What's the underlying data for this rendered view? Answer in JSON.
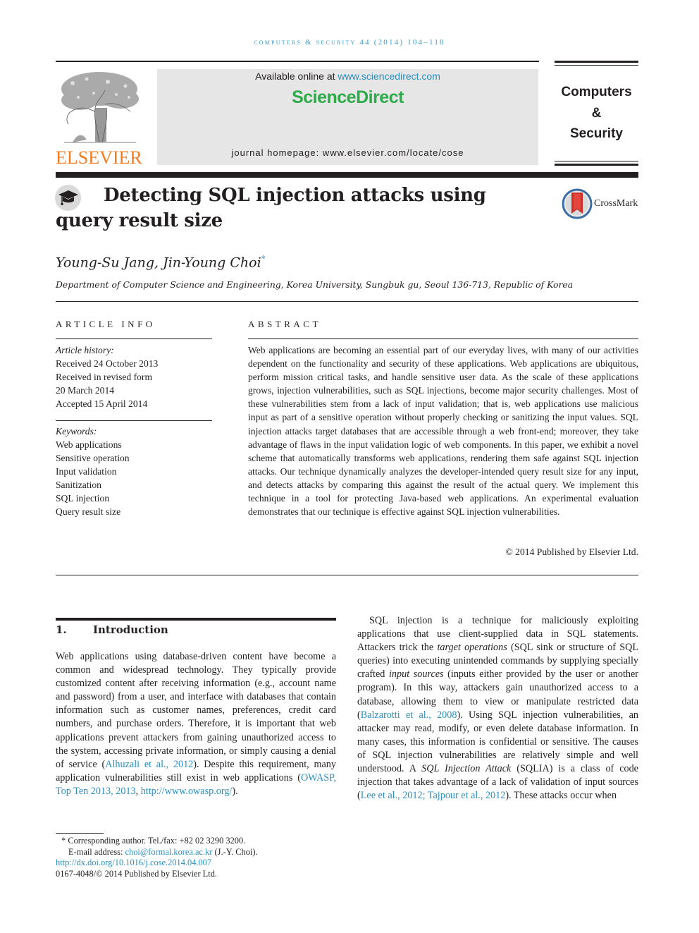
{
  "running_head": "computers & security 44 (2014) 104–118",
  "header": {
    "publisher_logo": "ELSEVIER",
    "available_online_prefix": "Available online at ",
    "available_online_link": "www.sciencedirect.com",
    "brand": "ScienceDirect",
    "journal_homepage": "journal homepage: www.elsevier.com/locate/cose",
    "journal_name_lines": [
      "Computers",
      "&",
      "Security"
    ]
  },
  "article": {
    "title": "Detecting SQL injection attacks using query result size",
    "crossmark_label": "CrossMark",
    "authors": "Young-Su Jang, Jin-Young Choi",
    "corresponding_marker": "*",
    "affiliation": "Department of Computer Science and Engineering, Korea University, Sungbuk gu, Seoul 136-713, Republic of Korea"
  },
  "article_info": {
    "heading": "ARTICLE INFO",
    "history_label": "Article history:",
    "history": [
      "Received 24 October 2013",
      "Received in revised form",
      "20 March 2014",
      "Accepted 15 April 2014"
    ],
    "keywords_label": "Keywords:",
    "keywords": [
      "Web applications",
      "Sensitive operation",
      "Input validation",
      "Sanitization",
      "SQL injection",
      "Query result size"
    ]
  },
  "abstract": {
    "heading": "ABSTRACT",
    "text": "Web applications are becoming an essential part of our everyday lives, with many of our activities dependent on the functionality and security of these applications. Web applications are ubiquitous, perform mission critical tasks, and handle sensitive user data. As the scale of these applications grows, injection vulnerabilities, such as SQL injections, become major security challenges. Most of these vulnerabilities stem from a lack of input validation; that is, web applications use malicious input as part of a sensitive operation without properly checking or sanitizing the input values. SQL injection attacks target databases that are accessible through a web front-end; moreover, they take advantage of flaws in the input validation logic of web components. In this paper, we exhibit a novel scheme that automatically transforms web applications, rendering them safe against SQL injection attacks. Our technique dynamically analyzes the developer-intended query result size for any input, and detects attacks by comparing this against the result of the actual query. We implement this technique in a tool for protecting Java-based web applications. An experimental evaluation demonstrates that our technique is effective against SQL injection vulnerabilities.",
    "copyright": "© 2014 Published by Elsevier Ltd."
  },
  "intro": {
    "number": "1.",
    "heading": "Introduction",
    "left": {
      "p1_a": "Web applications using database-driven content have become a common and widespread technology. They typically provide customized content after receiving information (e.g., account name and password) from a user, and interface with databases that contain information such as customer names, preferences, credit card numbers, and purchase orders. Therefore, it is important that web applications prevent attackers from gaining unauthorized access to the system, accessing private information, or simply causing a denial of service (",
      "cite1": "Alhuzali et al., 2012",
      "p1_b": "). Despite this requirement, many application vulnerabilities still exist in web applications (",
      "cite2": "OWASP, Top Ten 2013, 2013",
      "p1_c": ", ",
      "cite3": "http://www.owasp.org/",
      "p1_d": ")."
    },
    "right": {
      "a": "SQL injection is a technique for maliciously exploiting applications that use client-supplied data in SQL statements. Attackers trick the ",
      "em1": "target operations",
      "b": " (SQL sink or structure of SQL queries) into executing unintended commands by supplying specially crafted ",
      "em2": "input sources",
      "c": " (inputs either provided by the user or another program). In this way, attackers gain unauthorized access to a database, allowing them to view or manipulate restricted data (",
      "cite1": "Balzarotti et al., 2008",
      "d": "). Using SQL injection vulnerabilities, an attacker may read, modify, or even delete database information. In many cases, this information is confidential or sensitive. The causes of SQL injection vulnerabilities are relatively simple and well understood. A ",
      "em3": "SQL Injection Attack",
      "e": " (SQLIA) is a class of code injection that takes advantage of a lack of validation of input sources (",
      "cite2": "Lee et al., 2012; Tajpour et al., 2012",
      "f": "). These attacks occur when"
    }
  },
  "footnote": {
    "marker": "*",
    "corresponding": "Corresponding author. Tel./fax: +82 02 3290 3200.",
    "email_label": "E-mail address: ",
    "email": "choi@formal.korea.ac.kr",
    "email_suffix": " (J.-Y. Choi).",
    "doi": "http://dx.doi.org/10.1016/j.cose.2014.04.007",
    "issn": "0167-4048/© 2014 Published by Elsevier Ltd."
  },
  "colors": {
    "link": "#2a8fc1",
    "elsevier_orange": "#f47b20",
    "sciencedirect_green": "#2eaa4a",
    "header_gray": "#e6e6e6"
  }
}
